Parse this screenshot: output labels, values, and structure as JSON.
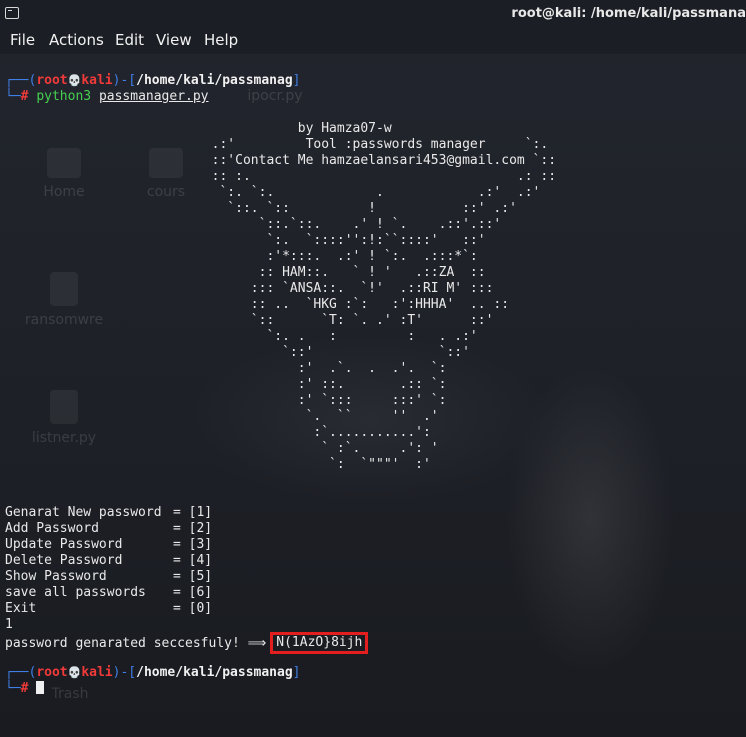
{
  "window": {
    "title": "root@kali: /home/kali/passmana"
  },
  "menubar": {
    "items": [
      "File",
      "Actions",
      "Edit",
      "View",
      "Help"
    ]
  },
  "desktop": {
    "icons": [
      "Home",
      "cours",
      "ransomwre",
      "listner.py",
      "ipocr.py",
      "Trash"
    ]
  },
  "prompt1": {
    "open": "┌──(",
    "user": "root",
    "skull": "💀",
    "host": "kali",
    "mid": ")-[",
    "path": "/home/kali/passmanag",
    "close": "]",
    "prefix": "└─",
    "hash": "#",
    "command": "python3",
    "argument": "passmanager.py"
  },
  "banner_lines": [
    "             by Hamza07-w",
    "  .:'         Tool :passwords manager     `:.",
    "  ::'Contact Me hamzaelansari453@gmail.com `::",
    "  :: :.                                  .: ::",
    "   `:. `:.             .            .:'  .:'",
    "    `::. `::          !           ::' .:'",
    "        `::.`::.    .' ! `.    .::'.::'",
    "         `:.  `::::'':!:``::::'   ::'",
    "         :'*:::.  .:' ! `:.  .:::*`:",
    "        :: HAM::.   ` ! '   .::ZA  ::",
    "       ::: `ANSA::.  `!'  .::RI M' :::",
    "       :: ..  `HKG :`:   :':HHHA'  .. ::",
    "       `::      `T: `. .' :T'      ::'",
    "         `:. .   :         :   . .:'",
    "           `::'                `::'",
    "             :'  .`.  .  .'.  `:",
    "             :' ::.       .:: `:",
    "             :' `:::     :::' `:",
    "              `.  ``     ''  .'",
    "               :`...........':",
    "                ` :`.     .': '",
    "                 `:  `\"\"\"'  :'"
  ],
  "menu_options": [
    {
      "label": "Genarat New password",
      "key": "[1]"
    },
    {
      "label": "Add Password",
      "key": "[2]"
    },
    {
      "label": "Update Password",
      "key": "[3]"
    },
    {
      "label": "Delete Password",
      "key": "[4]"
    },
    {
      "label": "Show Password",
      "key": "[5]"
    },
    {
      "label": "save all passwords",
      "key": "[6]"
    },
    {
      "label": "Exit",
      "key": "[0]"
    }
  ],
  "user_input": "1",
  "result": {
    "message": "password genarated seccesfuly!",
    "arrow": "⟹",
    "password": "N(1AzO}8ijh"
  },
  "prompt2": {
    "open": "┌──(",
    "user": "root",
    "skull": "💀",
    "host": "kali",
    "mid": ")-[",
    "path": "/home/kali/passmanag",
    "close": "]",
    "prefix": "└─",
    "hash": "#"
  },
  "colors": {
    "prompt_frame": "#3f7fe6",
    "root_user": "#f03a3a",
    "command": "#45d050",
    "highlight_box": "#e31e1e"
  }
}
